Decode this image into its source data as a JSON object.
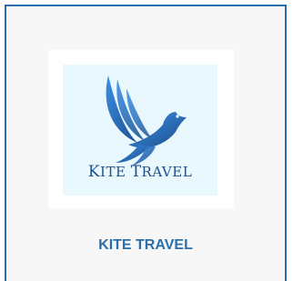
{
  "card": {
    "logo": {
      "icon": "bird-logo-icon",
      "text_parts": [
        {
          "big": "K",
          "small": "ITE"
        },
        {
          "big": "T",
          "small": "RAVEL"
        }
      ]
    },
    "title": "KITE TRAVEL",
    "colors": {
      "border": "#2a6faa",
      "title": "#2a6faa",
      "logo_bg": "#e9f8fd",
      "logo_text": "#1f4f8a"
    }
  }
}
